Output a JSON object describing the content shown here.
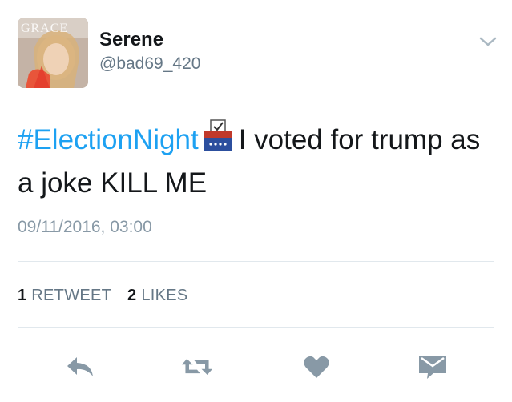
{
  "tweet": {
    "author_name": "Serene",
    "author_handle": "@bad69_420",
    "avatar_text": "GRACE",
    "hashtag": "#ElectionNight",
    "text": "I voted for trump as a joke KILL ME",
    "emoji": "ballot-box-icon",
    "timestamp": "09/11/2016, 03:00"
  },
  "stats": {
    "retweets_count": "1",
    "retweets_label": "RETWEET",
    "likes_count": "2",
    "likes_label": "LIKES"
  },
  "actions": [
    "reply-icon",
    "retweet-icon",
    "like-icon",
    "message-icon"
  ],
  "colors": {
    "link": "#1da1f2",
    "secondary_text": "#657786",
    "icon": "#8899a6",
    "divider": "#e1e8ed"
  }
}
